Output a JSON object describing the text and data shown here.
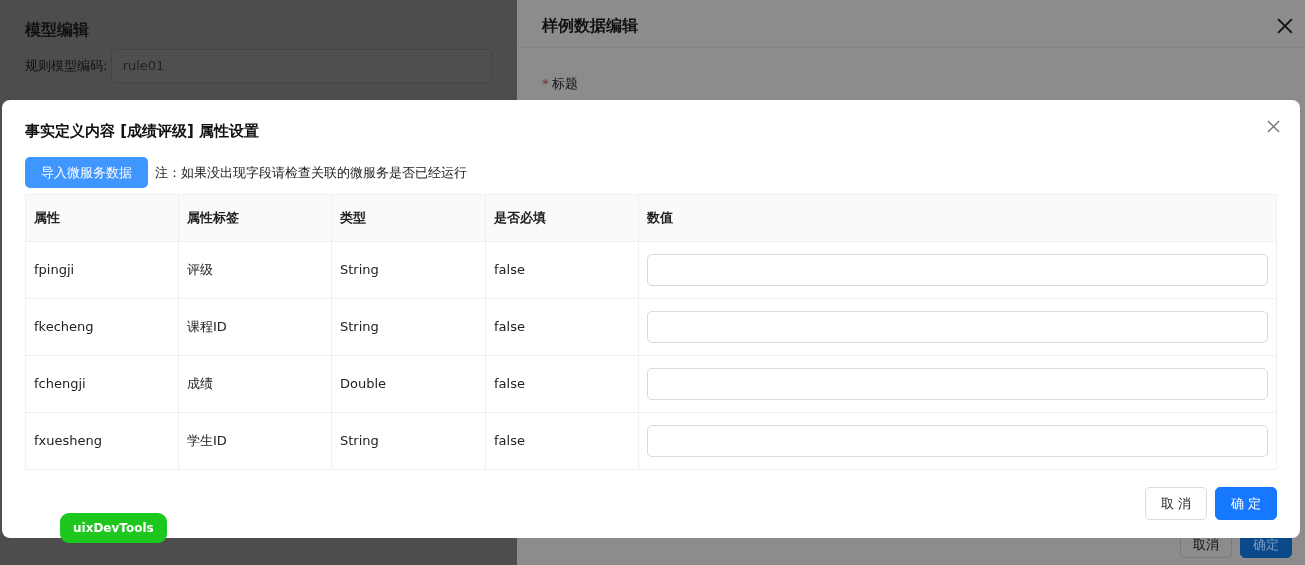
{
  "background_page": {
    "title": "模型编辑",
    "field_label": "规则模型编码:",
    "field_value": "rule01"
  },
  "drawer": {
    "title": "样例数据编辑",
    "required_mark": "*",
    "field_label": "标题",
    "buttons": [
      {
        "label": "取消",
        "kind": "default"
      },
      {
        "label": "确定",
        "kind": "primary"
      }
    ]
  },
  "modal": {
    "title": "事实定义内容 [成绩评级] 属性设置",
    "import_button": "导入微服务数据",
    "note": "注：如果没出现字段请检查关联的微服务是否已经运行",
    "table": {
      "columns": [
        "属性",
        "属性标签",
        "类型",
        "是否必填",
        "数值"
      ],
      "rows": [
        {
          "cells": [
            "fpingji",
            "评级",
            "String",
            "false"
          ]
        },
        {
          "cells": [
            "fkecheng",
            "课程ID",
            "String",
            "false"
          ]
        },
        {
          "cells": [
            "fchengji",
            "成绩",
            "Double",
            "false"
          ]
        },
        {
          "cells": [
            "fxuesheng",
            "学生ID",
            "String",
            "false"
          ]
        }
      ]
    },
    "buttons": [
      {
        "label": "取 消",
        "kind": "default"
      },
      {
        "label": "确 定",
        "kind": "primary"
      }
    ]
  },
  "dev_tools_badge": "uixDevTools"
}
